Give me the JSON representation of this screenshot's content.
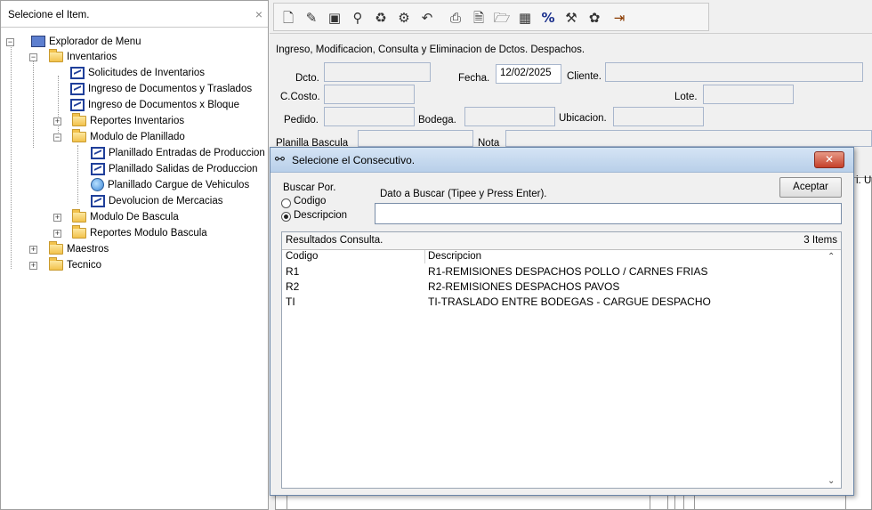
{
  "left_panel": {
    "title": "Selecione el Item.",
    "close_glyph": "×",
    "tree": {
      "root": "Explorador de Menu",
      "inventarios": "Inventarios",
      "inv_items": [
        "Solicitudes de Inventarios",
        "Ingreso de Documentos  y Traslados",
        "Ingreso de Documentos x Bloque"
      ],
      "reportes_inventarios": "Reportes Inventarios",
      "modulo_planillado": "Modulo de Planillado",
      "planillado_items": [
        "Planillado Entradas de Produccion",
        "Planillado Salidas de Produccion",
        "Planillado Cargue de Vehiculos",
        "Devolucion de Mercacias"
      ],
      "modulo_bascula": "Modulo De Bascula",
      "reportes_bascula": "Reportes Modulo Bascula",
      "maestros": "Maestros",
      "tecnico": "Tecnico"
    }
  },
  "toolbar": {
    "icons": [
      "new-file-icon",
      "edit-icon",
      "save-icon",
      "search-icon",
      "recycle-icon",
      "tools-icon",
      "undo-icon",
      "print-icon",
      "print-preview-icon",
      "open-folder-icon",
      "calculator-icon",
      "percent-icon",
      "hammer-icon",
      "gear-icon",
      "exit-icon"
    ]
  },
  "form": {
    "header": "Ingreso, Modificacion, Consulta y Eliminacion de Dctos. Despachos.",
    "dcto_label": "Dcto.",
    "fecha_label": "Fecha.",
    "fecha_value": "12/02/2025",
    "cliente_label": "Cliente.",
    "ccosto_label": "C.Costo.",
    "lote_label": "Lote.",
    "pedido_label": "Pedido.",
    "bodega_label": "Bodega.",
    "ubicacion_label": "Ubicacion.",
    "planilla_label": "Planilla Bascula",
    "nota_label": "Nota",
    "grid_partial_text": "i.  U"
  },
  "dialog": {
    "title": "Selecione el Consecutivo.",
    "close_glyph": "✕",
    "buscar_por_label": "Buscar Por.",
    "radio_codigo": "Codigo",
    "radio_descripcion": "Descripcion",
    "selected": "Descripcion",
    "dato_label": "Dato a  Buscar (Tipee y Press Enter).",
    "search_value": "",
    "accept_label": "Aceptar",
    "results_label": "Resultados Consulta.",
    "results_count": "3 Items",
    "columns": [
      "Codigo",
      "Descripcion"
    ],
    "rows": [
      {
        "codigo": "R1",
        "descripcion": "R1-REMISIONES DESPACHOS POLLO / CARNES FRIAS"
      },
      {
        "codigo": "R2",
        "descripcion": "R2-REMISIONES DESPACHOS PAVOS"
      },
      {
        "codigo": "TI",
        "descripcion": "TI-TRASLADO ENTRE BODEGAS  - CARGUE DESPACHO"
      }
    ]
  }
}
